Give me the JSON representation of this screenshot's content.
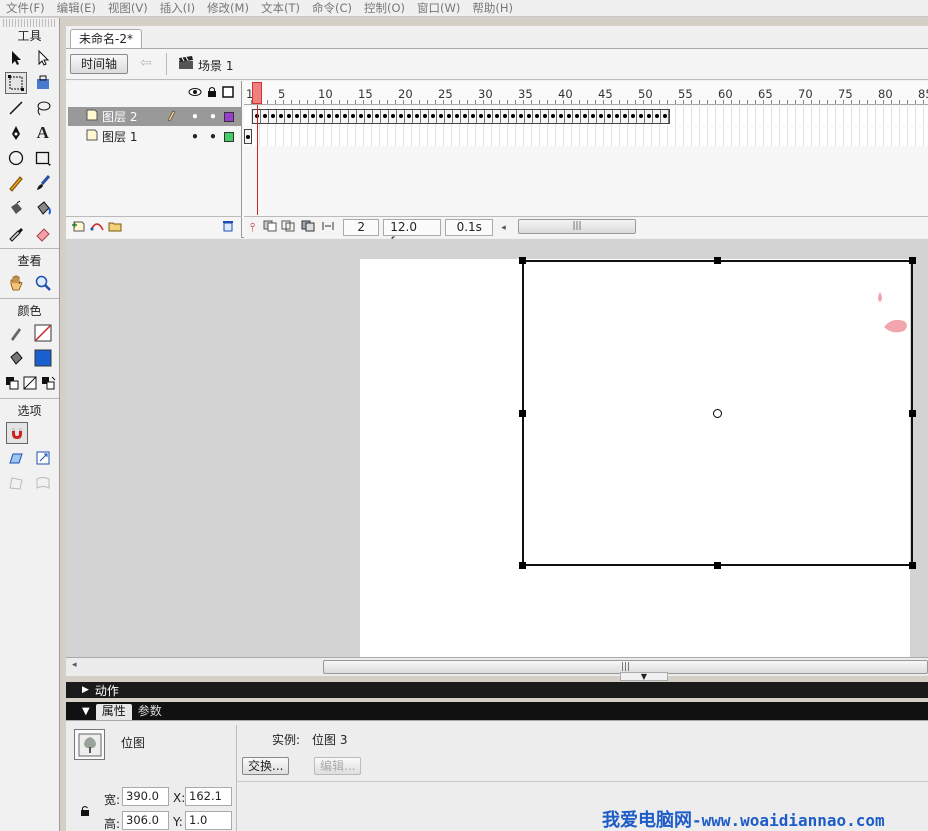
{
  "menubar": [
    "文件(F)",
    "编辑(E)",
    "视图(V)",
    "插入(I)",
    "修改(M)",
    "文本(T)",
    "命令(C)",
    "控制(O)",
    "窗口(W)",
    "帮助(H)"
  ],
  "tools": {
    "title": "工具",
    "view_title": "查看",
    "color_title": "颜色",
    "options_title": "选项",
    "stroke_color": "#cc2222",
    "fill_color": "#1a5fd0"
  },
  "document": {
    "tab_title": "未命名-2*",
    "timeline_button": "时间轴",
    "scene_label": "场景 1"
  },
  "timeline": {
    "ruler_labels": [
      "1",
      "5",
      "10",
      "15",
      "20",
      "25",
      "30",
      "35",
      "40",
      "45",
      "50",
      "55",
      "60",
      "65",
      "70",
      "75",
      "80",
      "85"
    ],
    "layers": [
      {
        "name": "图层 2",
        "selected": true,
        "color": "#9b3bd0"
      },
      {
        "name": "图层 1",
        "selected": false,
        "color": "#44cc66"
      }
    ],
    "current_frame": "2",
    "frame_rate": "12.0 fps",
    "elapsed": "0.1s",
    "tween_frames": 52
  },
  "panels": {
    "actions_label": "动作",
    "properties_tab": "属性",
    "params_tab": "参数"
  },
  "properties": {
    "type": "位图",
    "instance_label": "实例:",
    "instance_value": "位图 3",
    "swap_button": "交换...",
    "edit_button": "编辑...",
    "width_label": "宽:",
    "width_value": "390.0",
    "height_label": "高:",
    "height_value": "306.0",
    "x_label": "X:",
    "x_value": "162.1",
    "y_label": "Y:",
    "y_value": "1.0"
  },
  "watermark": {
    "text": "我爱电脑网",
    "url": "-www.woaidiannao.com"
  }
}
